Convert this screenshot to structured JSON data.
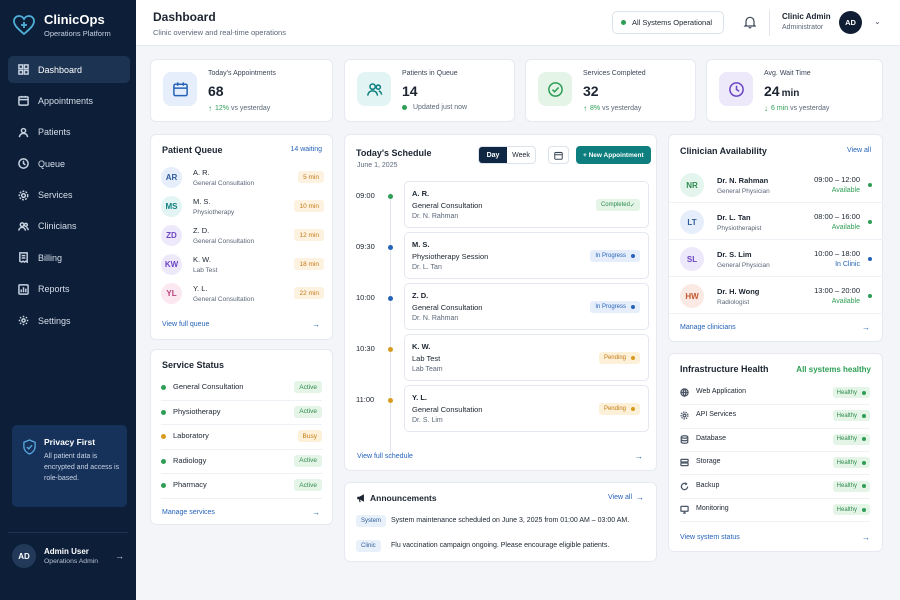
{
  "brand": {
    "name": "ClinicOps",
    "subtitle": "Operations Platform"
  },
  "sidebar": {
    "items": [
      {
        "label": "Dashboard",
        "icon": "grid-icon",
        "active": true
      },
      {
        "label": "Appointments",
        "icon": "calendar-icon"
      },
      {
        "label": "Patients",
        "icon": "user-icon"
      },
      {
        "label": "Queue",
        "icon": "clock-icon"
      },
      {
        "label": "Services",
        "icon": "gear-icon"
      },
      {
        "label": "Clinicians",
        "icon": "users-icon"
      },
      {
        "label": "Billing",
        "icon": "receipt-icon"
      },
      {
        "label": "Reports",
        "icon": "chart-icon"
      },
      {
        "label": "Settings",
        "icon": "settings-icon"
      }
    ],
    "privacy": {
      "title": "Privacy First",
      "text": "All patient data is encrypted and access is role-based."
    },
    "user": {
      "initials": "AD",
      "name": "Admin User",
      "role": "Operations Admin"
    }
  },
  "header": {
    "title": "Dashboard",
    "subtitle": "Clinic overview and real-time operations",
    "system_status": "All Systems Operational",
    "admin_name": "Clinic Admin",
    "admin_role": "Administrator",
    "admin_initials": "AD"
  },
  "stats": [
    {
      "label": "Today's Appointments",
      "value": "68",
      "unit": "",
      "meta_change": "12%",
      "meta_text": "vs yesterday",
      "icon": "calendar-icon",
      "color": "#2563b8",
      "bg": "#e6eefb"
    },
    {
      "label": "Patients in Queue",
      "value": "14",
      "unit": "",
      "meta_change": "",
      "meta_text": "Updated just now",
      "icon": "users-icon",
      "color": "#0e7f7e",
      "bg": "#e2f4f3"
    },
    {
      "label": "Services Completed",
      "value": "32",
      "unit": "",
      "meta_change": "8%",
      "meta_text": "vs yesterday",
      "icon": "check-circle-icon",
      "color": "#2e9e55",
      "bg": "#e4f5e8"
    },
    {
      "label": "Avg. Wait Time",
      "value": "24",
      "unit": "min",
      "meta_change": "6 min",
      "meta_text": "vs yesterday",
      "icon": "clock-icon",
      "color": "#6b46c1",
      "bg": "#eee8fb"
    }
  ],
  "queue": {
    "title": "Patient Queue",
    "count_label": "14 waiting",
    "footer": "View full queue",
    "rows": [
      {
        "initials": "AR",
        "name": "A. R.",
        "type": "General Consultation",
        "time": "5 min",
        "bg": "#e6eefb",
        "fg": "#2f5d9a"
      },
      {
        "initials": "MS",
        "name": "M. S.",
        "type": "Physiotherapy",
        "time": "10 min",
        "bg": "#e2f4f3",
        "fg": "#0e7f7e"
      },
      {
        "initials": "ZD",
        "name": "Z. D.",
        "type": "General Consultation",
        "time": "12 min",
        "bg": "#eee8fb",
        "fg": "#6b46c1"
      },
      {
        "initials": "KW",
        "name": "K. W.",
        "type": "Lab Test",
        "time": "18 min",
        "bg": "#eee8fb",
        "fg": "#6b46c1"
      },
      {
        "initials": "YL",
        "name": "Y. L.",
        "type": "General Consultation",
        "time": "22 min",
        "bg": "#fbe8f1",
        "fg": "#b8407a"
      }
    ]
  },
  "service_status": {
    "title": "Service Status",
    "footer": "Manage services",
    "rows": [
      {
        "name": "General Consultation",
        "status": "Active",
        "color": "#2e9e55"
      },
      {
        "name": "Physiotherapy",
        "status": "Active",
        "color": "#2e9e55"
      },
      {
        "name": "Laboratory",
        "status": "Busy",
        "color": "#d89b1d"
      },
      {
        "name": "Radiology",
        "status": "Active",
        "color": "#2e9e55"
      },
      {
        "name": "Pharmacy",
        "status": "Active",
        "color": "#2e9e55"
      }
    ]
  },
  "schedule": {
    "title": "Today's Schedule",
    "date": "June 1, 2025",
    "view_day": "Day",
    "view_week": "Week",
    "new_button": "+ New Appointment",
    "footer": "View full schedule",
    "items": [
      {
        "time": "09:00",
        "name": "A. R.",
        "type": "General Consultation",
        "doctor": "Dr. N. Rahman",
        "status": "Completed",
        "kind": "done",
        "dot": "#2e9e55"
      },
      {
        "time": "09:30",
        "name": "M. S.",
        "type": "Physiotherapy Session",
        "doctor": "Dr. L. Tan",
        "status": "In Progress",
        "kind": "prog",
        "dot": "#2563b8"
      },
      {
        "time": "10:00",
        "name": "Z. D.",
        "type": "General Consultation",
        "doctor": "Dr. N. Rahman",
        "status": "In Progress",
        "kind": "prog",
        "dot": "#2563b8"
      },
      {
        "time": "10:30",
        "name": "K. W.",
        "type": "Lab Test",
        "doctor": "Lab Team",
        "status": "Pending",
        "kind": "pend",
        "dot": "#d89b1d"
      },
      {
        "time": "11:00",
        "name": "Y. L.",
        "type": "General Consultation",
        "doctor": "Dr. S. Lim",
        "status": "Pending",
        "kind": "pend",
        "dot": "#d89b1d"
      }
    ]
  },
  "announcements": {
    "title": "Announcements",
    "view_all": "View all",
    "items": [
      {
        "tag": "System",
        "text": "System maintenance scheduled on June 3, 2025 from 01:00 AM – 03:00 AM."
      },
      {
        "tag": "Clinic",
        "text": "Flu vaccination campaign ongoing. Please encourage eligible patients."
      }
    ]
  },
  "clinicians": {
    "title": "Clinician Availability",
    "view_all": "View all",
    "footer": "Manage clinicians",
    "rows": [
      {
        "initials": "NR",
        "name": "Dr. N. Rahman",
        "role": "General Physician",
        "hours": "09:00 – 12:00",
        "status": "Available",
        "status_color": "#2e9e55",
        "bg": "#e4f5ee",
        "fg": "#2e8a4b"
      },
      {
        "initials": "LT",
        "name": "Dr. L. Tan",
        "role": "Physiotherapist",
        "hours": "08:00 – 16:00",
        "status": "Available",
        "status_color": "#2e9e55",
        "bg": "#e6eefb",
        "fg": "#2f5d9a"
      },
      {
        "initials": "SL",
        "name": "Dr. S. Lim",
        "role": "General Physician",
        "hours": "10:00 – 18:00",
        "status": "In Clinic",
        "status_color": "#2563b8",
        "bg": "#eee8fb",
        "fg": "#6b46c1"
      },
      {
        "initials": "HW",
        "name": "Dr. H. Wong",
        "role": "Radiologist",
        "hours": "13:00 – 20:00",
        "status": "Available",
        "status_color": "#2e9e55",
        "bg": "#fbeae3",
        "fg": "#c2562e"
      }
    ]
  },
  "infrastructure": {
    "title": "Infrastructure Health",
    "summary": "All systems healthy",
    "footer": "View system status",
    "rows": [
      {
        "name": "Web Application",
        "status": "Healthy",
        "icon": "globe-icon"
      },
      {
        "name": "API Services",
        "status": "Healthy",
        "icon": "gear-icon"
      },
      {
        "name": "Database",
        "status": "Healthy",
        "icon": "database-icon"
      },
      {
        "name": "Storage",
        "status": "Healthy",
        "icon": "storage-icon"
      },
      {
        "name": "Backup",
        "status": "Healthy",
        "icon": "backup-icon"
      },
      {
        "name": "Monitoring",
        "status": "Healthy",
        "icon": "monitor-icon"
      }
    ]
  }
}
